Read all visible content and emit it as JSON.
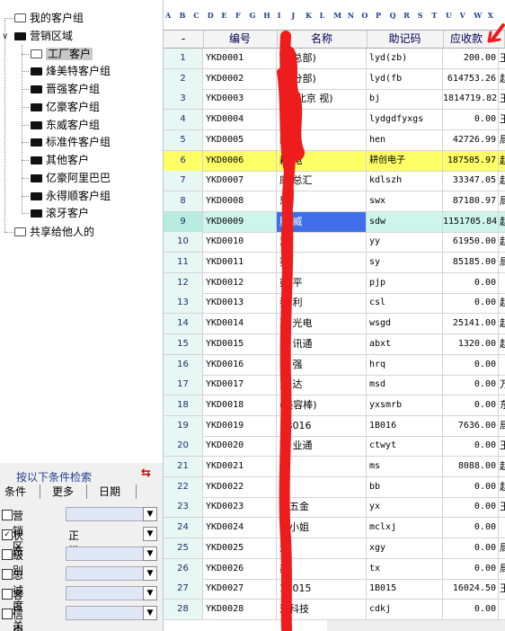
{
  "tree": {
    "my_groups": "我的客户组",
    "sales_area": "营销区域",
    "children": [
      "工厂客户",
      "烽美特客户组",
      "晋强客户组",
      "亿豪客户组",
      "东威客户组",
      "标准件客户组",
      "其他客户",
      "亿豪阿里巴巴",
      "永得顺客户组",
      "滚牙客户"
    ],
    "selected_child": "工厂客户",
    "shared": "共享给他人的"
  },
  "filter": {
    "title": "按以下条件检索",
    "tabs": [
      "条件",
      "更多",
      "日期"
    ],
    "fields": [
      {
        "label": "营销区",
        "checked": false,
        "value": ""
      },
      {
        "label": "状态",
        "checked": true,
        "value": "正常"
      },
      {
        "label": "级别",
        "checked": false,
        "value": ""
      },
      {
        "label": "忠诚度",
        "checked": false,
        "value": ""
      },
      {
        "label": "客户关系",
        "checked": false,
        "value": ""
      },
      {
        "label": "信用",
        "checked": false,
        "value": ""
      }
    ]
  },
  "grid": {
    "column_letters": [
      "A",
      "B",
      "C",
      "D",
      "E",
      "F",
      "G",
      "H",
      "I",
      "J",
      "K",
      "L",
      "M",
      "N",
      "O",
      "P",
      "Q",
      "R",
      "S",
      "T",
      "U",
      "V",
      "W",
      "X"
    ],
    "header": {
      "index": "-",
      "code": "编号",
      "name": "名称",
      "mnemonic": "助记码",
      "receivable": "应收款"
    },
    "rows": [
      {
        "idx": "1",
        "code": "YKD0001",
        "name": "利   总部)",
        "mnem": "lyd(zb)",
        "amt": "200.00",
        "extra": "王"
      },
      {
        "idx": "2",
        "code": "YKD0002",
        "name": "利   分部)",
        "mnem": "lyd(fb",
        "amt": "614753.26",
        "extra": "赵"
      },
      {
        "idx": "3",
        "code": "YKD0003",
        "name": "利   (北京   视)",
        "mnem": "bj",
        "amt": "1814719.82",
        "extra": "王"
      },
      {
        "idx": "4",
        "code": "YKD0004",
        "name": "利",
        "mnem": "lydgdfyxgs",
        "amt": "0.00",
        "extra": "王"
      },
      {
        "idx": "5",
        "code": "YKD0005",
        "name": "赫",
        "mnem": "hen",
        "amt": "42726.99",
        "extra": "局"
      },
      {
        "idx": "6",
        "code": "YKD0006",
        "name": "耕   电",
        "mnem": "耕创电子",
        "amt": "187505.97",
        "extra": "赵"
      },
      {
        "idx": "7",
        "code": "YKD0007",
        "name": "康   总汇",
        "mnem": "kdlszh",
        "amt": "33347.05",
        "extra": "赵"
      },
      {
        "idx": "8",
        "code": "YKD0008",
        "name": "思",
        "mnem": "swx",
        "amt": "87180.97",
        "extra": "局"
      },
      {
        "idx": "9",
        "code": "YKD0009",
        "name": "胜   威",
        "mnem": "sdw",
        "amt": "1151705.84",
        "extra": "赵"
      },
      {
        "idx": "10",
        "code": "YKD0010",
        "name": "意",
        "mnem": "yy",
        "amt": "61950.00",
        "extra": "赵"
      },
      {
        "idx": "11",
        "code": "YKD0011",
        "name": "赛",
        "mnem": "sy",
        "amt": "85185.00",
        "extra": "局"
      },
      {
        "idx": "12",
        "code": "YKD0012",
        "name": "彭   平",
        "mnem": "pjp",
        "amt": "0.00",
        "extra": ""
      },
      {
        "idx": "13",
        "code": "YKD0013",
        "name": "蔡   利",
        "mnem": "csl",
        "amt": "0.00",
        "extra": "赵"
      },
      {
        "idx": "14",
        "code": "YKD0014",
        "name": "万   光电",
        "mnem": "wsgd",
        "amt": "25141.00",
        "extra": "赵"
      },
      {
        "idx": "15",
        "code": "YKD0015",
        "name": "安   讯通",
        "mnem": "abxt",
        "amt": "1320.00",
        "extra": "赵"
      },
      {
        "idx": "16",
        "code": "YKD0016",
        "name": "黄   强",
        "mnem": "hrq",
        "amt": "0.00",
        "extra": ""
      },
      {
        "idx": "17",
        "code": "YKD0017",
        "name": "苏   达",
        "mnem": "msd",
        "amt": "0.00",
        "extra": "万"
      },
      {
        "idx": "18",
        "code": "YKD0018",
        "name": "   (美容棒)",
        "mnem": "yxsmrb",
        "amt": "0.00",
        "extra": "东"
      },
      {
        "idx": "19",
        "code": "YKD0019",
        "name": "1B016",
        "mnem": "1B016",
        "amt": "7636.00",
        "extra": "局"
      },
      {
        "idx": "20",
        "code": "YKD0020",
        "name": "   天   业通",
        "mnem": "ctwyt",
        "amt": "0.00",
        "extra": "王"
      },
      {
        "idx": "21",
        "code": "YKD0021",
        "name": "   思",
        "mnem": "ms",
        "amt": "8088.00",
        "extra": "赵"
      },
      {
        "idx": "22",
        "code": "YKD0022",
        "name": "   标",
        "mnem": "bb",
        "amt": "0.00",
        "extra": "赵"
      },
      {
        "idx": "23",
        "code": "YKD0023",
        "name": "   鑫五金",
        "mnem": "yx",
        "amt": "0.00",
        "extra": "王"
      },
      {
        "idx": "24",
        "code": "YKD0024",
        "name": "   李小姐",
        "mnem": "mclxj",
        "amt": "0.00",
        "extra": ""
      },
      {
        "idx": "25",
        "code": "YKD0025",
        "name": "   源",
        "mnem": "xgy",
        "amt": "0.00",
        "extra": "局"
      },
      {
        "idx": "26",
        "code": "YKD0026",
        "name": "   鑫",
        "mnem": "tx",
        "amt": "0.00",
        "extra": "局"
      },
      {
        "idx": "27",
        "code": "YKD0027",
        "name": "1B015",
        "mnem": "1B015",
        "amt": "16024.50",
        "extra": "王"
      },
      {
        "idx": "28",
        "code": "YKD0028",
        "name": "   迪科技",
        "mnem": "cdkj",
        "amt": "0.00",
        "extra": ""
      }
    ],
    "highlighted_row": "6",
    "selected_row": "9"
  },
  "colors": {
    "highlight": "#ffff66",
    "selection": "#3f6ee8",
    "index_bg": "#e6f7f4",
    "annotation": "#ee1c1c"
  }
}
